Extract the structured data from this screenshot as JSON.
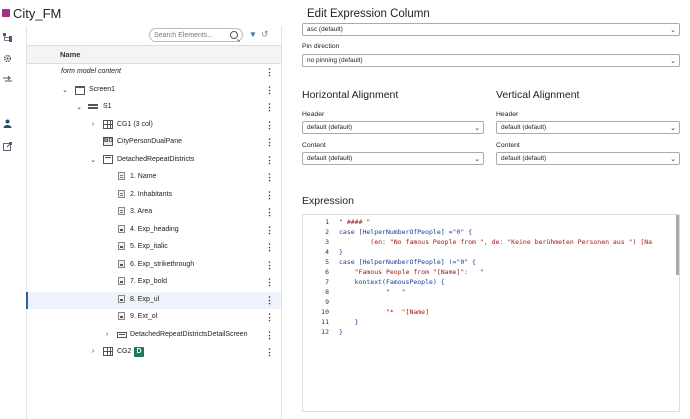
{
  "window": {
    "title": "City_FM"
  },
  "rail": {
    "icons": [
      "hierarchy-icon",
      "gear-icon",
      "swap-icon",
      "person-icon",
      "link-out-icon"
    ]
  },
  "toolbar": {
    "search_placeholder": "Search Elements..."
  },
  "tree": {
    "column_header": "Name",
    "rows": [
      {
        "label": "form model content",
        "italic": true
      },
      {
        "label": "Screen1"
      },
      {
        "label": "S1"
      },
      {
        "label": "CG1 (3 col)"
      },
      {
        "label": "CityPersonDualPane",
        "icon_text": "BG"
      },
      {
        "label": "DetachedRepeatDistricts"
      },
      {
        "label": "1. Name"
      },
      {
        "label": "2. Inhabitants"
      },
      {
        "label": "3. Area"
      },
      {
        "label": "4. Exp_heading"
      },
      {
        "label": "5. Exp_italic"
      },
      {
        "label": "6. Exp_strikethrough"
      },
      {
        "label": "7. Exp_bold"
      },
      {
        "label": "8. Exp_ul"
      },
      {
        "label": "9. Ext_ol"
      },
      {
        "label": "DetachedRepeatDistrictsDetailScreen"
      },
      {
        "label": "CG2",
        "badge": "D"
      }
    ],
    "selected_row": "8. Exp_ul"
  },
  "panel": {
    "title": "Edit Expression Column",
    "sort_value": "asc (default)",
    "pin_label": "Pin direction",
    "pin_value": "no pinning (default)",
    "horizontal": {
      "title": "Horizontal Alignment",
      "header_label": "Header",
      "header_value": "default (default)",
      "content_label": "Content",
      "content_value": "default (default)"
    },
    "vertical": {
      "title": "Vertical Alignment",
      "header_label": "Header",
      "header_value": "default (default)",
      "content_label": "Content",
      "content_value": "default (default)"
    },
    "expression_title": "Expression"
  },
  "editor": {
    "lines": [
      "\" #### \"",
      "case [HelperNumberOfPeople] =\"0\" {",
      "        (en: \"No famous People from \", de: \"Keine berühmeten Personen aus \") [Na",
      "}",
      "case [HelperNumberOfPeople] !=\"0\" {",
      "    \"Famous People from \"[Name]\":   \"",
      "    kontext(FamousPeople) {",
      "            \"   \"",
      "",
      "            \"*  \"[Name]",
      "    }",
      "}"
    ],
    "line_numbers": [
      "1",
      "2",
      "3",
      "4",
      "5",
      "6",
      "7",
      "8",
      "9",
      "10",
      "11",
      "12"
    ]
  },
  "colors": {
    "accent": "#2d5fa3",
    "badge_green": "#1a7a5a",
    "app_icon": "#a2307f"
  }
}
